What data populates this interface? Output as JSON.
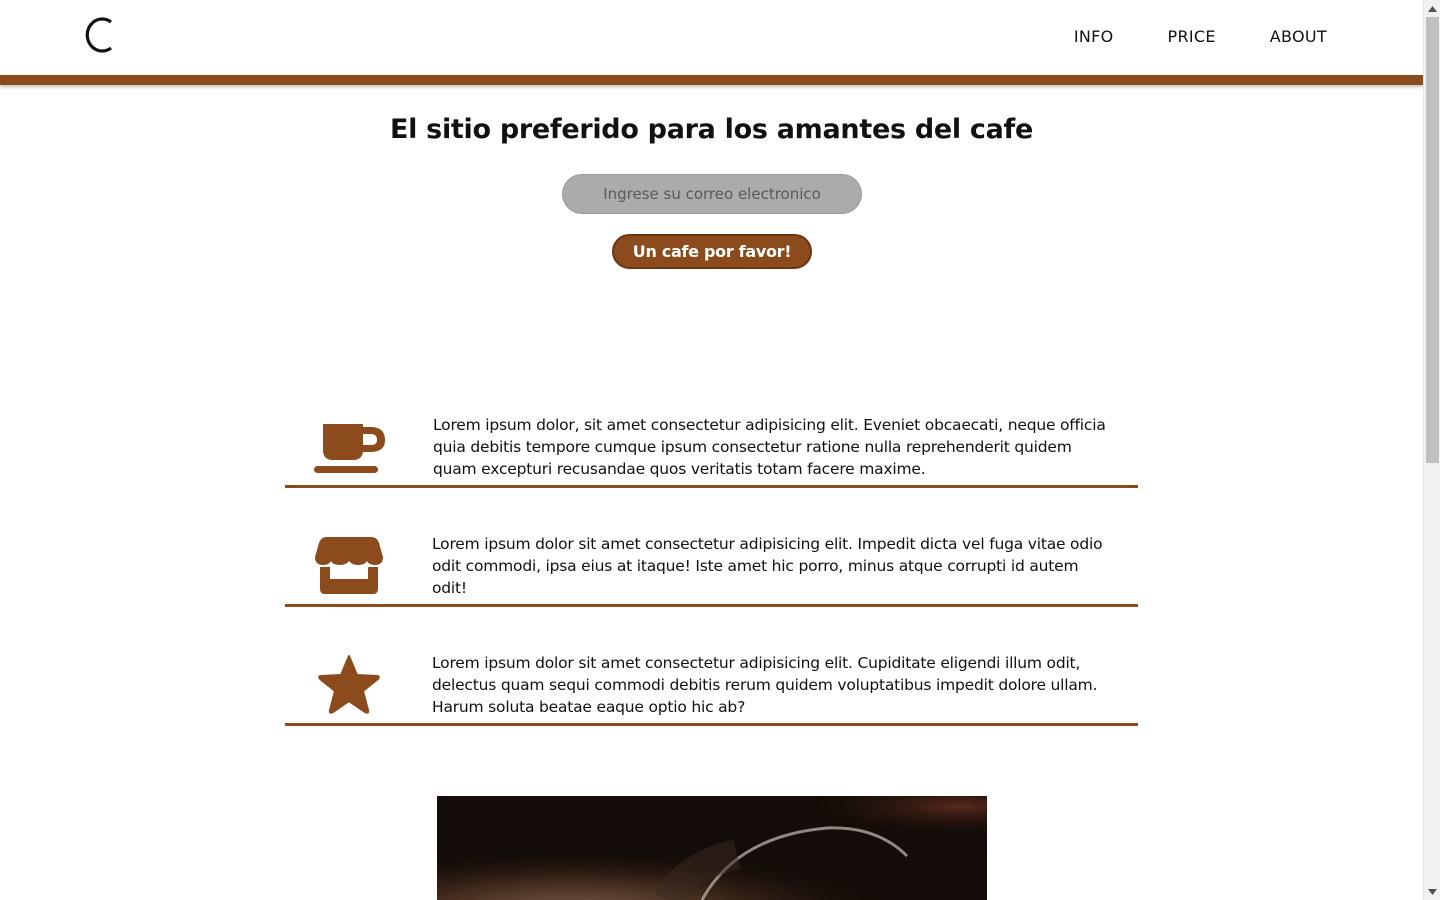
{
  "header": {
    "logo_letter": "C",
    "nav": [
      {
        "label": "INFO"
      },
      {
        "label": "PRICE"
      },
      {
        "label": "ABOUT"
      }
    ]
  },
  "hero": {
    "title": "El sitio preferido para los amantes del cafe",
    "email_placeholder": "Ingrese su correo electronico",
    "cta_label": "Un cafe por favor!"
  },
  "features": [
    {
      "icon": "coffee-cup-icon",
      "text": "Lorem ipsum dolor, sit amet consectetur adipisicing elit. Eveniet obcaecati, neque officia quia debitis tempore cumque ipsum consectetur ratione nulla reprehenderit quidem quam excepturi recusandae quos veritatis totam facere maxime."
    },
    {
      "icon": "store-icon",
      "text": "Lorem ipsum dolor sit amet consectetur adipisicing elit. Impedit dicta vel fuga vitae odio odit commodi, ipsa eius at itaque! Iste amet hic porro, minus atque corrupti id autem odit!"
    },
    {
      "icon": "star-icon",
      "text": "Lorem ipsum dolor sit amet consectetur adipisicing elit. Cupiditate eligendi illum odit, delectus quam sequi commodi debitis rerum quidem voluptatibus impedit dolore ullam. Harum soluta beatae eaque optio hic ab?"
    }
  ],
  "colors": {
    "accent": "#8b4b1c",
    "input_bg": "#ababab",
    "background": "#ffffff"
  }
}
